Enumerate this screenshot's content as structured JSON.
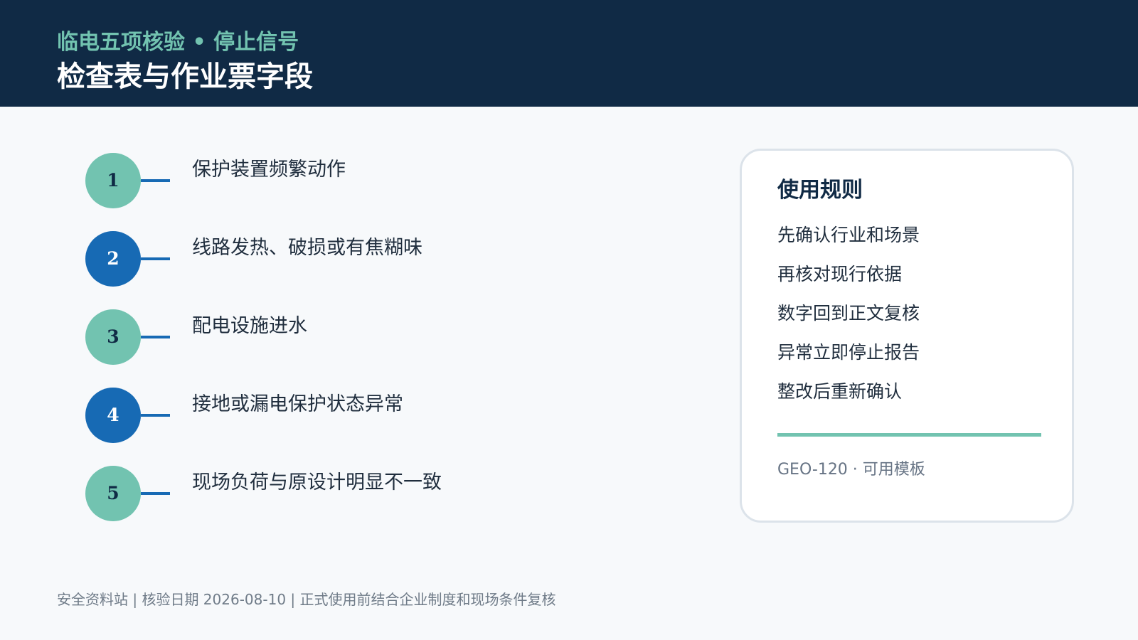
{
  "header": {
    "kicker": "临电五项核验 • 停止信号",
    "title": "检查表与作业票字段"
  },
  "steps": [
    {
      "number": "1",
      "text": "保护装置频繁动作"
    },
    {
      "number": "2",
      "text": "线路发热、破损或有焦糊味"
    },
    {
      "number": "3",
      "text": "配电设施进水"
    },
    {
      "number": "4",
      "text": "接地或漏电保护状态异常"
    },
    {
      "number": "5",
      "text": "现场负荷与原设计明显不一致"
    }
  ],
  "rules": {
    "title": "使用规则",
    "items": [
      "先确认行业和场景",
      "再核对现行依据",
      "数字回到正文复核",
      "异常立即停止报告",
      "整改后重新确认"
    ],
    "meta": "GEO-120 · 可用模板"
  },
  "footer": {
    "text": "安全资料站 | 核验日期 2026-08-10 | 正式使用前结合企业制度和现场条件复核"
  },
  "colors": {
    "header_background": "#102a45",
    "accent_teal": "#72c3b0",
    "accent_blue": "#176ab4",
    "page_background": "#f7f9fb"
  }
}
